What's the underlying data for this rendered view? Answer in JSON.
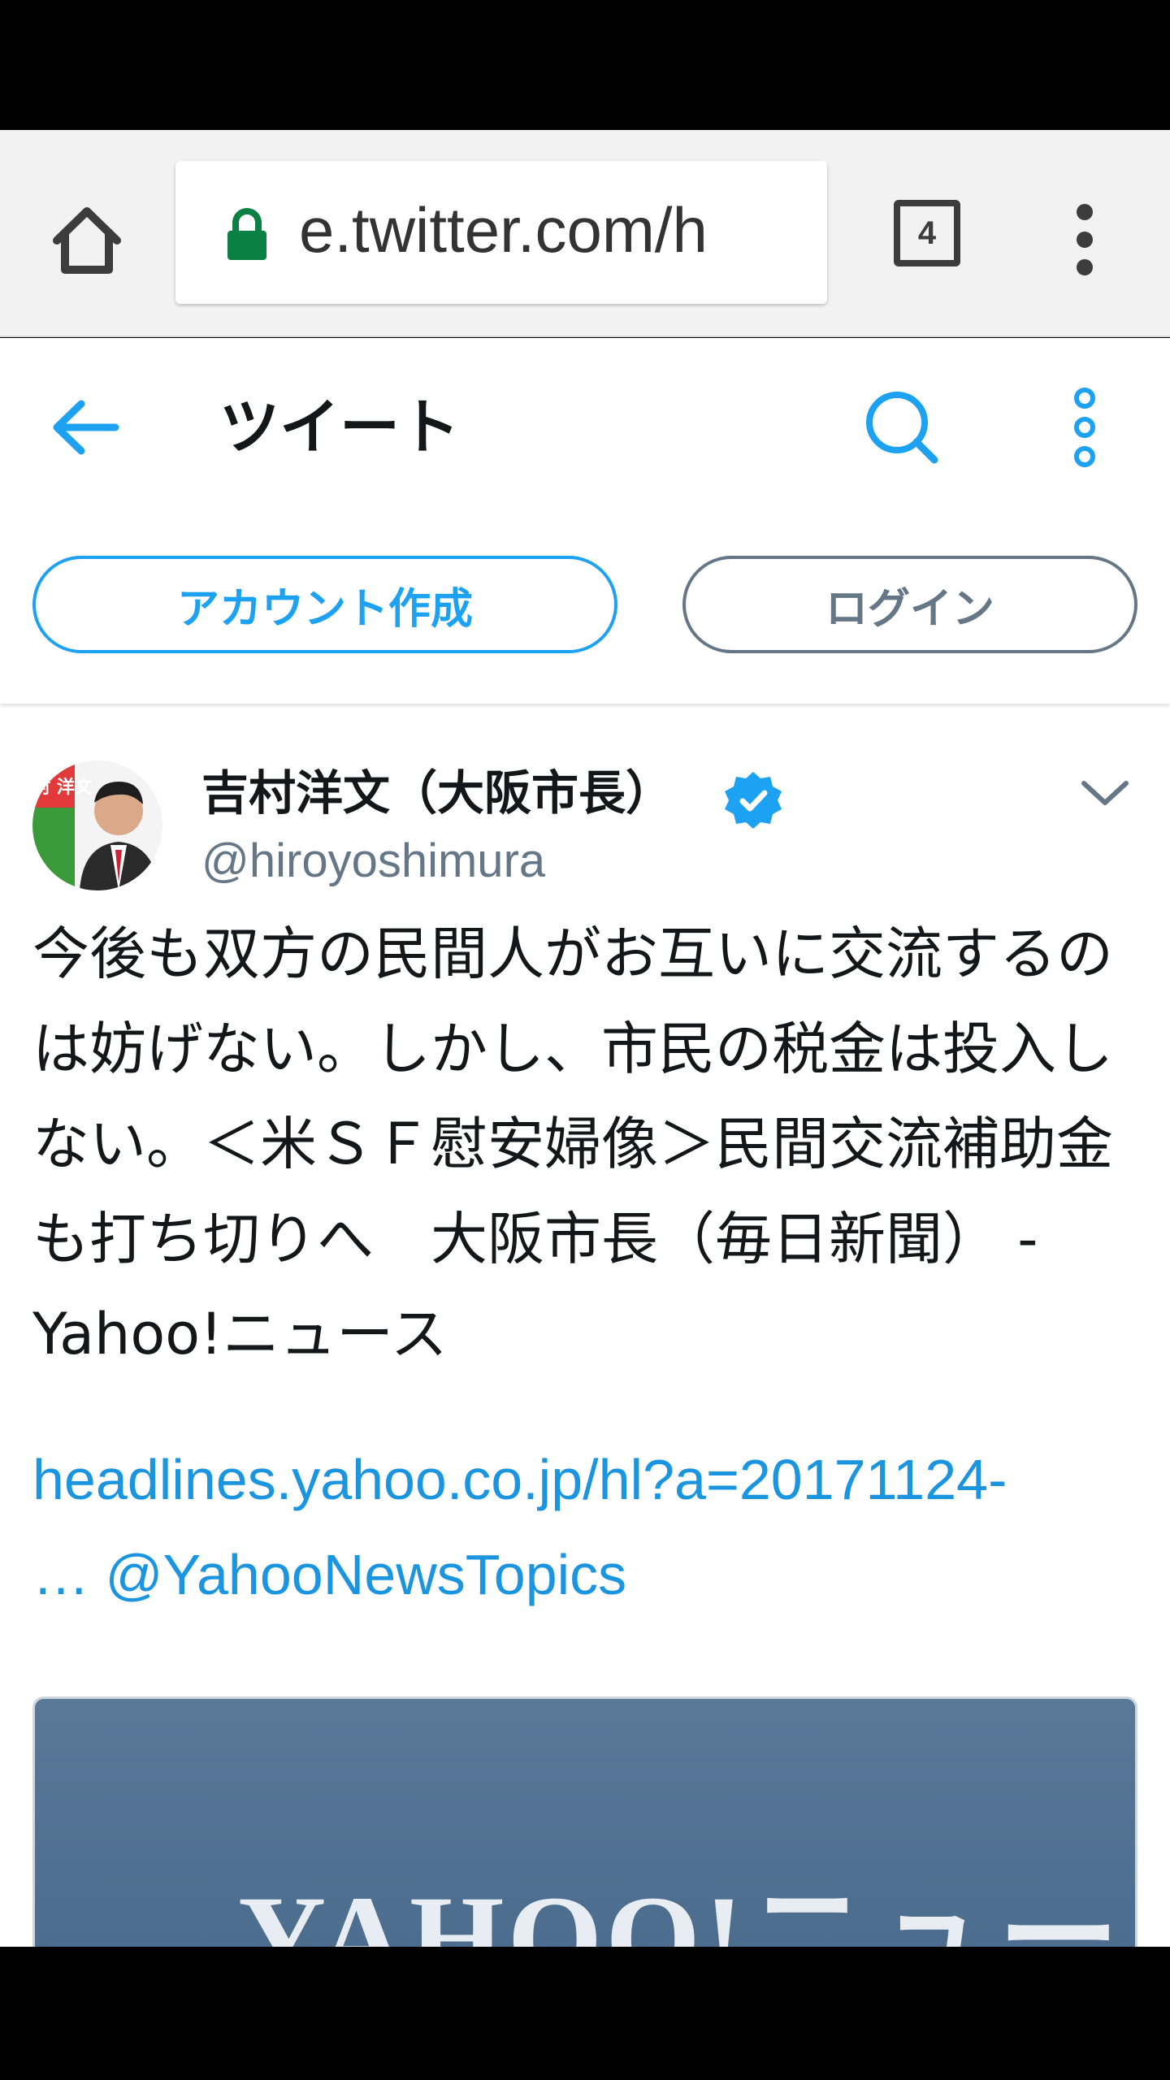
{
  "browser": {
    "url": "e.twitter.com/h",
    "tab_count": "4"
  },
  "header": {
    "title": "ツイート"
  },
  "auth": {
    "signup_label": "アカウント作成",
    "login_label": "ログイン"
  },
  "tweet": {
    "author_name": "吉村洋文（大阪市長）",
    "handle": "@hiroyoshimura",
    "avatar_text": "吉村 洋文",
    "text": "今後も双方の民間人がお互いに交流するのは妨げない。しかし、市民の税金は投入しない。＜米ＳＦ慰安婦像＞民間交流補助金も打ち切りへ　大阪市長（毎日新聞） - Yahoo!ニュース",
    "link_line1": "headlines.yahoo.co.jp/hl?a=20171124-",
    "link_line2": "… @YahooNewsTopics",
    "card_logo_text": "YAHOO!ニュース"
  },
  "colors": {
    "twitter_blue": "#1da1f2",
    "link_blue": "#1b95e0",
    "secondary_gray": "#657786",
    "lock_green": "#0b8043"
  }
}
